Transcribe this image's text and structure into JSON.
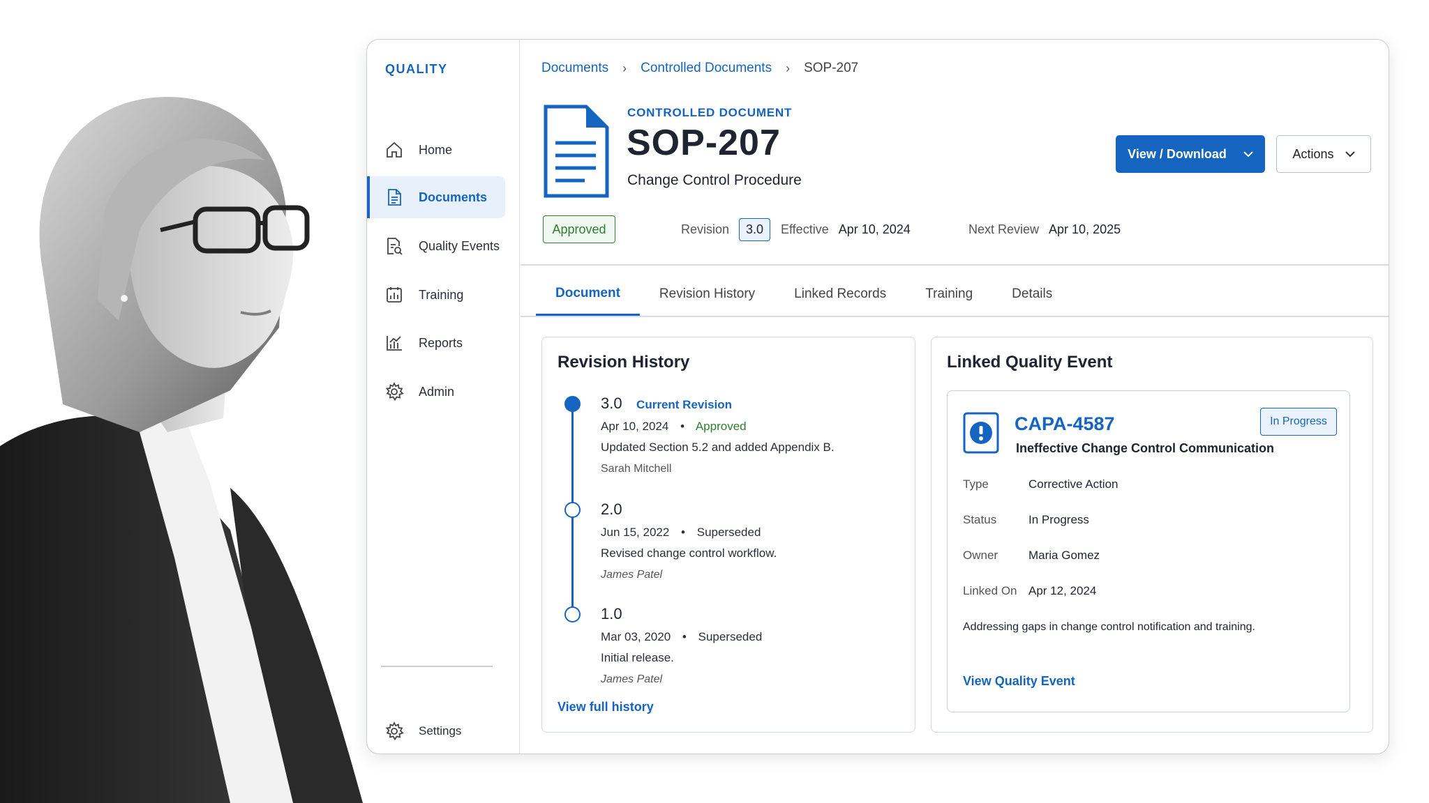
{
  "sidebar": {
    "brand": "QUALITY",
    "items": [
      {
        "label": "Home",
        "icon": "home-icon"
      },
      {
        "label": "Documents",
        "icon": "document-icon",
        "active": true
      },
      {
        "label": "Quality Events",
        "icon": "quality-event-icon"
      },
      {
        "label": "Training",
        "icon": "training-icon"
      },
      {
        "label": "Reports",
        "icon": "reports-icon"
      },
      {
        "label": "Admin",
        "icon": "gear-icon"
      }
    ],
    "settings": "Settings"
  },
  "breadcrumb": [
    "Documents",
    "Controlled Documents",
    "SOP-207"
  ],
  "document": {
    "kind": "CONTROLLED DOCUMENT",
    "id": "SOP-207",
    "title": "Change Control Procedure",
    "status": "Approved",
    "revision_label": "Revision",
    "revision": "3.0",
    "effective_label": "Effective",
    "effective": "Apr 10, 2024",
    "next_review_label": "Next Review",
    "next_review": "Apr 10, 2025"
  },
  "actions": {
    "view_download": "View / Download",
    "actions": "Actions"
  },
  "tabs": [
    "Document",
    "Revision History",
    "Linked Records",
    "Training",
    "Details"
  ],
  "revision_history": {
    "title": "Revision History",
    "entries": [
      {
        "version": "3.0",
        "tag": "Current Revision",
        "date": "Apr 10, 2024",
        "status": "Approved",
        "note": "Updated Section 5.2 and added Appendix B.",
        "author": "Sarah Mitchell"
      },
      {
        "version": "2.0",
        "date": "Jun 15, 2022",
        "status": "Superseded",
        "note": "Revised change control workflow.",
        "author": "James Patel"
      },
      {
        "version": "1.0",
        "date": "Mar 03, 2020",
        "status": "Superseded",
        "note": "Initial release.",
        "author": "James Patel"
      }
    ],
    "link": "View full history"
  },
  "linked_event": {
    "title": "Linked Quality Event",
    "id": "CAPA-4587",
    "name": "Ineffective Change Control Communication",
    "badge": "In Progress",
    "fields": [
      {
        "key": "Type",
        "value": "Corrective Action"
      },
      {
        "key": "Status",
        "value": "In Progress"
      },
      {
        "key": "Owner",
        "value": "Maria Gomez"
      },
      {
        "key": "Linked On",
        "value": "Apr 12, 2024"
      }
    ],
    "description": "Addressing gaps in change control notification and training.",
    "link": "View Quality Event"
  },
  "colors": {
    "accent": "#1565c0",
    "approved": "#2e7d32"
  }
}
